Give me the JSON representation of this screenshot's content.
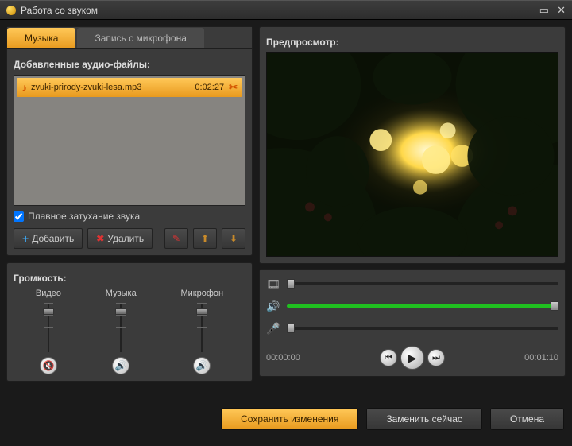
{
  "window": {
    "title": "Работа со звуком"
  },
  "tabs": {
    "music": "Музыка",
    "record": "Запись с микрофона"
  },
  "files": {
    "header": "Добавленные аудио-файлы:",
    "items": [
      {
        "name": "zvuki-prirody-zvuki-lesa.mp3",
        "duration": "0:02:27"
      }
    ],
    "fade_label": "Плавное затухание звука",
    "fade_checked": true
  },
  "buttons": {
    "add": "Добавить",
    "delete": "Удалить"
  },
  "volume": {
    "header": "Громкость:",
    "video": {
      "label": "Видео",
      "value": 85,
      "muted": true
    },
    "music": {
      "label": "Музыка",
      "value": 85,
      "muted": false
    },
    "mic": {
      "label": "Микрофон",
      "value": 85,
      "muted": false
    }
  },
  "preview": {
    "header": "Предпросмотр:",
    "time_current": "00:00:00",
    "time_total": "00:01:10",
    "video_pos": 0,
    "audio_level": 100,
    "mic_level": 0
  },
  "footer": {
    "save": "Сохранить изменения",
    "replace": "Заменить сейчас",
    "cancel": "Отмена"
  }
}
